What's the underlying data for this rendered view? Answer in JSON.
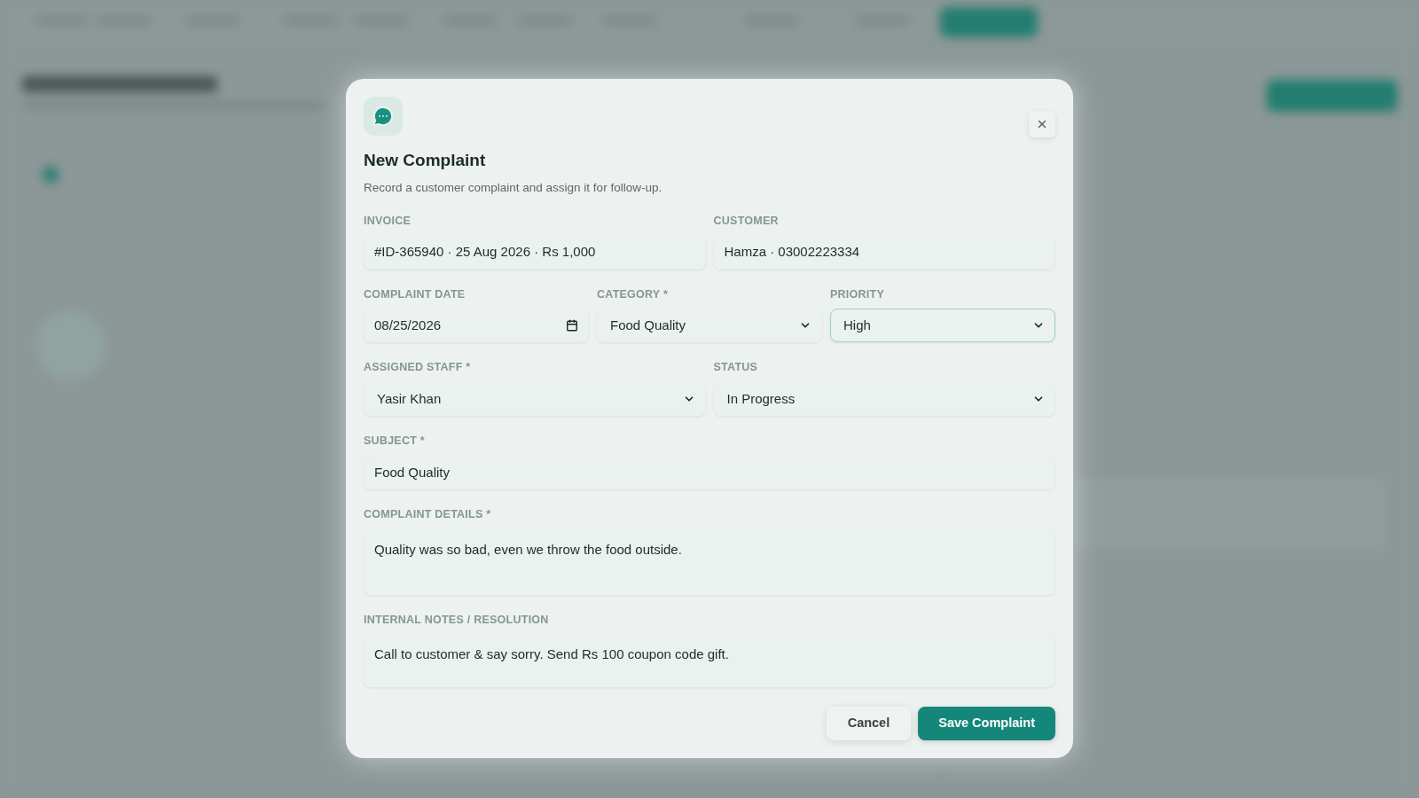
{
  "dialog": {
    "title": "New Complaint",
    "subtitle": "Record a customer complaint and assign it for follow-up.",
    "rows": [
      [
        {
          "label": "INVOICE",
          "kind": "text",
          "value": "#ID-365940 · 25 Aug 2026 · Rs 1,000",
          "focused": false
        },
        {
          "label": "CUSTOMER",
          "kind": "text",
          "value": "Hamza · 03002223334",
          "focused": false
        }
      ],
      [
        {
          "label": "COMPLAINT DATE",
          "kind": "date",
          "value": "08/25/2026",
          "focused": false
        },
        {
          "label": "CATEGORY *",
          "kind": "select",
          "value": "Food Quality",
          "focused": false
        },
        {
          "label": "PRIORITY",
          "kind": "select",
          "value": "High",
          "focused": true
        }
      ],
      [
        {
          "label": "ASSIGNED STAFF *",
          "kind": "select",
          "value": "Yasir Khan",
          "focused": false
        },
        {
          "label": "STATUS",
          "kind": "select",
          "value": "In Progress",
          "focused": false
        }
      ],
      [
        {
          "label": "SUBJECT *",
          "kind": "text",
          "value": "Food Quality",
          "focused": false
        }
      ],
      [
        {
          "label": "COMPLAINT DETAILS *",
          "kind": "textarea",
          "value": "Quality was so bad, even we throw the food outside.",
          "focused": false
        }
      ],
      [
        {
          "label": "INTERNAL NOTES / RESOLUTION",
          "kind": "notes",
          "value": "Call to customer & say sorry. Send Rs 100 coupon code gift.",
          "focused": false
        }
      ]
    ],
    "buttons": [
      {
        "label": "Cancel",
        "kind": "secondary"
      },
      {
        "label": "Save Complaint",
        "kind": "primary"
      }
    ]
  }
}
